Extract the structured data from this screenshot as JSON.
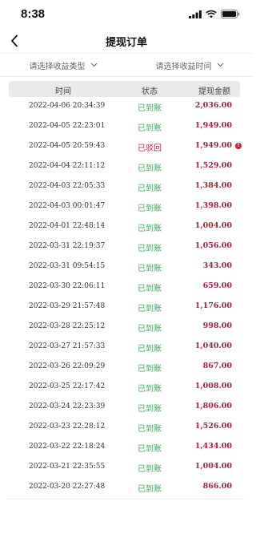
{
  "status_bar": {
    "time": "8:38"
  },
  "nav": {
    "title": "提现订单"
  },
  "filters": [
    {
      "label": "请选择收益类型"
    },
    {
      "label": "请选择收益时间"
    }
  ],
  "table": {
    "headers": {
      "time": "时间",
      "status": "状态",
      "amount": "提现金额"
    },
    "colors": {
      "arrived": "#3cab5e",
      "rejected": "#c8233d",
      "amount": "#a5223a"
    },
    "rows": [
      {
        "time": "2022-04-06 20:34:39",
        "status": "已到账",
        "amount": "2,036.00",
        "rejected": false
      },
      {
        "time": "2022-04-05 22:23:01",
        "status": "已到账",
        "amount": "1,949.00",
        "rejected": false
      },
      {
        "time": "2022-04-05 20:59:43",
        "status": "已驳回",
        "amount": "1,949.00",
        "rejected": true
      },
      {
        "time": "2022-04-04 22:11:12",
        "status": "已到账",
        "amount": "1,529.00",
        "rejected": false
      },
      {
        "time": "2022-04-03 22:05:33",
        "status": "已到账",
        "amount": "1,384.00",
        "rejected": false
      },
      {
        "time": "2022-04-03 00:01:47",
        "status": "已到账",
        "amount": "1,398.00",
        "rejected": false
      },
      {
        "time": "2022-04-01 22:48:14",
        "status": "已到账",
        "amount": "1,004.00",
        "rejected": false
      },
      {
        "time": "2022-03-31 22:19:37",
        "status": "已到账",
        "amount": "1,056.00",
        "rejected": false
      },
      {
        "time": "2022-03-31 09:54:15",
        "status": "已到账",
        "amount": "343.00",
        "rejected": false
      },
      {
        "time": "2022-03-30 22:06:11",
        "status": "已到账",
        "amount": "659.00",
        "rejected": false
      },
      {
        "time": "2022-03-29 21:57:48",
        "status": "已到账",
        "amount": "1,176.00",
        "rejected": false
      },
      {
        "time": "2022-03-28 22:25:12",
        "status": "已到账",
        "amount": "998.00",
        "rejected": false
      },
      {
        "time": "2022-03-27 21:57:33",
        "status": "已到账",
        "amount": "1,040.00",
        "rejected": false
      },
      {
        "time": "2022-03-26 22:09:29",
        "status": "已到账",
        "amount": "867.00",
        "rejected": false
      },
      {
        "time": "2022-03-25 22:17:42",
        "status": "已到账",
        "amount": "1,008.00",
        "rejected": false
      },
      {
        "time": "2022-03-24 22:23:39",
        "status": "已到账",
        "amount": "1,806.00",
        "rejected": false
      },
      {
        "time": "2022-03-23 22:28:12",
        "status": "已到账",
        "amount": "1,526.00",
        "rejected": false
      },
      {
        "time": "2022-03-22 22:18:24",
        "status": "已到账",
        "amount": "1,434.00",
        "rejected": false
      },
      {
        "time": "2022-03-21 22:35:55",
        "status": "已到账",
        "amount": "1,004.00",
        "rejected": false
      },
      {
        "time": "2022-03-20 22:27:48",
        "status": "已到账",
        "amount": "866.00",
        "rejected": false
      }
    ]
  }
}
